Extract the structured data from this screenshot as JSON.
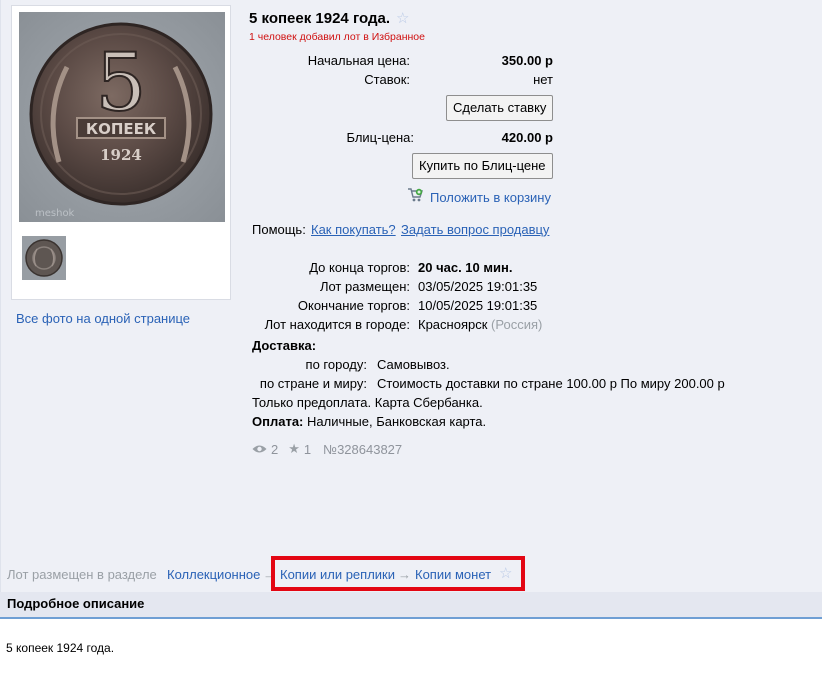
{
  "lot": {
    "title": "5 копеек 1924 года.",
    "favorites_note": "1 человек добавил лот в Избранное",
    "start_price_label": "Начальная цена:",
    "start_price": "350.00 р",
    "bids_label": "Ставок:",
    "bids_value": "нет",
    "bid_button": "Сделать ставку",
    "blitz_label": "Блиц-цена:",
    "blitz_price": "420.00 р",
    "blitz_button": "Купить по Блиц-цене",
    "cart_link": "Положить в корзину",
    "help_label": "Помощь:",
    "help_how": "Как покупать?",
    "help_ask": "Задать вопрос продавцу"
  },
  "photos": {
    "all_photos_link": "Все фото на одной странице",
    "watermark": "meshok",
    "coin_text": {
      "denomination": "5",
      "word": "КОПЕЕК",
      "year": "1924"
    }
  },
  "timing": {
    "end_label": "До конца торгов:",
    "end_value": "20 час. 10 мин.",
    "placed_label": "Лот размещен:",
    "placed_value": "03/05/2025 19:01:35",
    "close_label": "Окончание торгов:",
    "close_value": "10/05/2025 19:01:35",
    "city_label": "Лот находится в городе:",
    "city_value": "Красноярск",
    "country": "(Россия)"
  },
  "delivery": {
    "heading": "Доставка:",
    "city_label": "по городу:",
    "city_value": "Самовывоз.",
    "country_label": "по стране и миру:",
    "country_value": "Стоимость доставки по стране 100.00 р По миру 200.00 р",
    "prepay_note": "Только предоплата. Карта Сбербанка.",
    "payment_label": "Оплата:",
    "payment_value": "Наличные, Банковская карта."
  },
  "stats": {
    "views": "2",
    "stars": "1",
    "lot_number": "№328643827"
  },
  "breadcrumb": {
    "prefix": "Лот размещен в разделе",
    "items": [
      "Коллекционное",
      "Копии или реплики",
      "Копии монет"
    ],
    "separator": "→"
  },
  "description": {
    "header": "Подробное описание",
    "text": "5 копеек 1924 года."
  },
  "colors": {
    "link": "#2a62b6",
    "alert_red": "#d01010",
    "highlight_box": "#e30613",
    "panel_bg": "#eef0f6"
  }
}
